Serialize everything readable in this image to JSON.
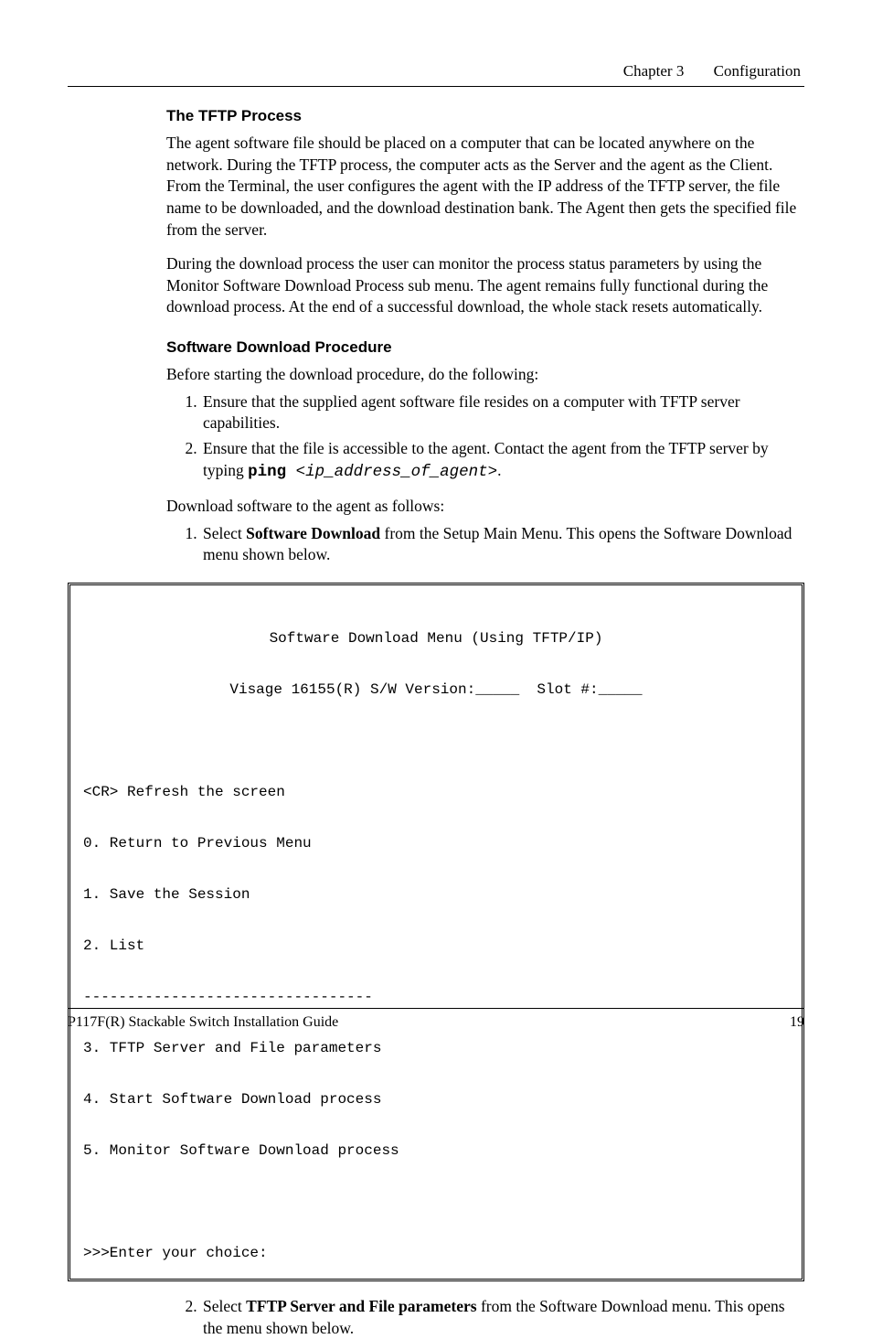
{
  "header": {
    "chapter": "Chapter 3",
    "title": "Configuration"
  },
  "section1": {
    "heading": "The TFTP Process",
    "p1": "The agent software file should be placed on a computer that can be located anywhere on the network. During the TFTP process, the computer acts as the Server and the agent as the Client. From the Terminal, the user configures the agent with the IP address of the TFTP server, the file name to be downloaded, and the download destination bank. The Agent then gets the specified file from the server.",
    "p2": "During the download process the user can monitor the process status parameters by using the Monitor Software Download Process sub menu. The agent remains fully functional during the download process. At the end of a successful download, the whole stack resets automatically."
  },
  "section2": {
    "heading": "Software Download Procedure",
    "intro": "Before starting the download procedure, do the following:",
    "pre_item1": "Ensure that the supplied agent software file resides on a computer with TFTP server capabilities.",
    "pre_item2_a": "Ensure that the file is accessible to the agent. Contact the agent from the TFTP server by typing ",
    "pre_item2_cmd": "ping",
    "pre_item2_arg": " <ip_address_of_agent>",
    "pre_item2_end": ".",
    "dl_intro": "Download software to the agent as follows:",
    "dl_item1_a": "Select ",
    "dl_item1_b": "Software Download",
    "dl_item1_c": " from the Setup Main Menu. This opens the Software Download menu shown below.",
    "dl_item2_a": "Select ",
    "dl_item2_b": "TFTP Server and File parameters",
    "dl_item2_c": " from the Software Download menu. This opens the menu shown below."
  },
  "menu": {
    "title": "Software Download Menu (Using TFTP/IP)",
    "subtitle": "Visage 16155(R) S/W Version:_____  Slot #:_____",
    "l_cr": "<CR> Refresh the screen",
    "l0": "0. Return to Previous Menu",
    "l1": "1. Save the Session",
    "l2": "2. List",
    "sep": "---------------------------------",
    "l3": "3. TFTP Server and File parameters",
    "l4": "4. Start Software Download process",
    "l5": "5. Monitor Software Download process",
    "prompt": ">>>Enter your choice:"
  },
  "footer": {
    "left": "P117F(R) Stackable Switch Installation Guide",
    "right": "19"
  }
}
